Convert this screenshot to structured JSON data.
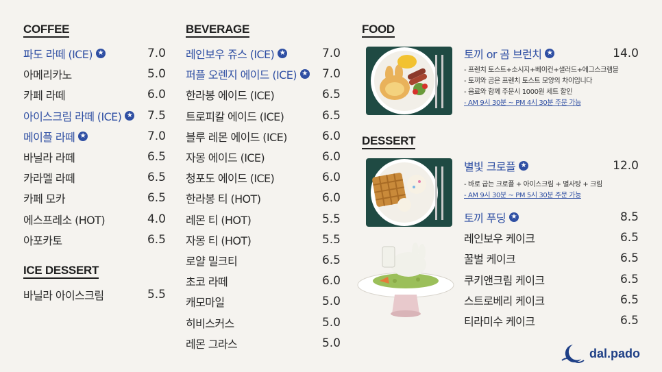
{
  "coffee": {
    "title": "COFFEE",
    "items": [
      {
        "name": "파도 라떼 (ICE)",
        "price": "7.0",
        "star": true
      },
      {
        "name": "아메리카노",
        "price": "5.0"
      },
      {
        "name": "카페 라떼",
        "price": "6.0"
      },
      {
        "name": "아이스크림 라떼 (ICE)",
        "price": "7.5",
        "star": true
      },
      {
        "name": "메이플 라떼",
        "price": "7.0",
        "star": true
      },
      {
        "name": "바닐라 라떼",
        "price": "6.5"
      },
      {
        "name": "카라멜 라떼",
        "price": "6.5"
      },
      {
        "name": "카페 모카",
        "price": "6.5"
      },
      {
        "name": "에스프레소 (HOT)",
        "price": "4.0"
      },
      {
        "name": "아포카토",
        "price": "6.5"
      }
    ]
  },
  "ice_dessert": {
    "title": "ICE DESSERT",
    "items": [
      {
        "name": "바닐라 아이스크림",
        "price": "5.5"
      }
    ]
  },
  "beverage": {
    "title": "BEVERAGE",
    "items": [
      {
        "name": "레인보우 쥬스 (ICE)",
        "price": "7.0",
        "star": true
      },
      {
        "name": "퍼플 오렌지 에이드 (ICE)",
        "price": "7.0",
        "star": true
      },
      {
        "name": "한라봉 에이드 (ICE)",
        "price": "6.5"
      },
      {
        "name": "트로피칼 에이드 (ICE)",
        "price": "6.5"
      },
      {
        "name": "블루 레몬 에이드 (ICE)",
        "price": "6.0"
      },
      {
        "name": "자몽 에이드 (ICE)",
        "price": "6.0"
      },
      {
        "name": "청포도 에이드 (ICE)",
        "price": "6.0"
      },
      {
        "name": "한라봉 티 (HOT)",
        "price": "6.0"
      },
      {
        "name": "레몬 티 (HOT)",
        "price": "5.5"
      },
      {
        "name": "자몽 티 (HOT)",
        "price": "5.5"
      },
      {
        "name": "로얄 밀크티",
        "price": "6.5"
      },
      {
        "name": "초코 라떼",
        "price": "6.0"
      },
      {
        "name": "캐모마일",
        "price": "5.0"
      },
      {
        "name": "히비스커스",
        "price": "5.0"
      },
      {
        "name": "레몬 그라스",
        "price": "5.0"
      }
    ]
  },
  "food": {
    "title": "FOOD",
    "item": {
      "name": "토끼 or 곰 브런치",
      "price": "14.0",
      "star": true
    },
    "desc": [
      "- 프렌치 토스트+소시지+베이컨+샐러드+에그스크램블",
      "- 토끼와 곰은 프렌치 토스트 모양의 차이입니다",
      "- 음료와 함께 주문시 1000원 세트 할인"
    ],
    "hours": "- AM 9시 30분 ~ PM 4시 30분 주문 가능"
  },
  "dessert": {
    "title": "DESSERT",
    "feature": {
      "name": "별빛 크로플",
      "price": "12.0",
      "star": true
    },
    "desc": [
      "- 바로 굽는 크로플 + 아이스크림 + 별사탕 + 크림"
    ],
    "hours": "- AM 9시 30분 ~ PM 5시 30분 주문 가능",
    "items": [
      {
        "name": "토끼 푸딩",
        "price": "8.5",
        "star": true
      },
      {
        "name": "레인보우 케이크",
        "price": "6.5"
      },
      {
        "name": "꿀벌 케이크",
        "price": "6.5"
      },
      {
        "name": "쿠키앤크림 케이크",
        "price": "6.5"
      },
      {
        "name": "스트로베리 케이크",
        "price": "6.5"
      },
      {
        "name": "티라미수 케이크",
        "price": "6.5"
      }
    ]
  },
  "logo": {
    "text": "dal.pado"
  },
  "colors": {
    "accent": "#2f4fa3",
    "background": "#f5f3ef",
    "text": "#2b2b2b"
  }
}
